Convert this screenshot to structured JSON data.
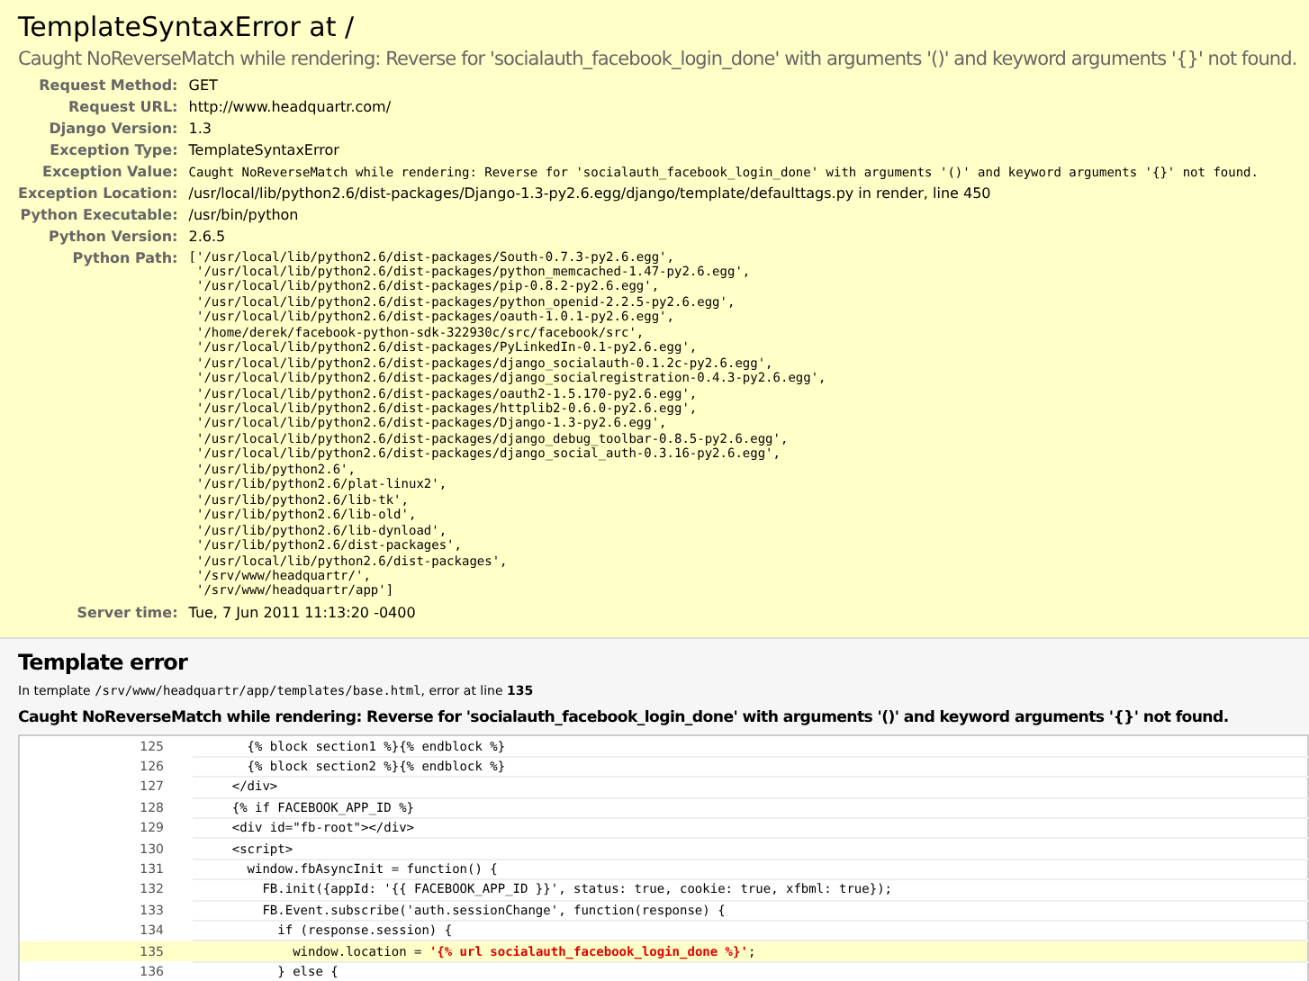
{
  "header": {
    "title": "TemplateSyntaxError at /",
    "message": "Caught NoReverseMatch while rendering: Reverse for 'socialauth_facebook_login_done' with arguments '()' and keyword arguments '{}' not found."
  },
  "meta": [
    {
      "label": "Request Method:",
      "kind": "text",
      "value": "GET"
    },
    {
      "label": "Request URL:",
      "kind": "text",
      "value": "http://www.headquartr.com/"
    },
    {
      "label": "Django Version:",
      "kind": "text",
      "value": "1.3"
    },
    {
      "label": "Exception Type:",
      "kind": "text",
      "value": "TemplateSyntaxError"
    },
    {
      "label": "Exception Value:",
      "kind": "mono",
      "value": "Caught NoReverseMatch while rendering: Reverse for 'socialauth_facebook_login_done' with arguments '()' and keyword arguments '{}' not found."
    },
    {
      "label": "Exception Location:",
      "kind": "text",
      "value": "/usr/local/lib/python2.6/dist-packages/Django-1.3-py2.6.egg/django/template/defaulttags.py in render, line 450"
    },
    {
      "label": "Python Executable:",
      "kind": "text",
      "value": "/usr/bin/python"
    },
    {
      "label": "Python Version:",
      "kind": "text",
      "value": "2.6.5"
    },
    {
      "label": "Python Path:",
      "kind": "lines",
      "lines": [
        "['/usr/local/lib/python2.6/dist-packages/South-0.7.3-py2.6.egg',",
        " '/usr/local/lib/python2.6/dist-packages/python_memcached-1.47-py2.6.egg',",
        " '/usr/local/lib/python2.6/dist-packages/pip-0.8.2-py2.6.egg',",
        " '/usr/local/lib/python2.6/dist-packages/python_openid-2.2.5-py2.6.egg',",
        " '/usr/local/lib/python2.6/dist-packages/oauth-1.0.1-py2.6.egg',",
        " '/home/derek/facebook-python-sdk-322930c/src/facebook/src',",
        " '/usr/local/lib/python2.6/dist-packages/PyLinkedIn-0.1-py2.6.egg',",
        " '/usr/local/lib/python2.6/dist-packages/django_socialauth-0.1.2c-py2.6.egg',",
        " '/usr/local/lib/python2.6/dist-packages/django_socialregistration-0.4.3-py2.6.egg',",
        " '/usr/local/lib/python2.6/dist-packages/oauth2-1.5.170-py2.6.egg',",
        " '/usr/local/lib/python2.6/dist-packages/httplib2-0.6.0-py2.6.egg',",
        " '/usr/local/lib/python2.6/dist-packages/Django-1.3-py2.6.egg',",
        " '/usr/local/lib/python2.6/dist-packages/django_debug_toolbar-0.8.5-py2.6.egg',",
        " '/usr/local/lib/python2.6/dist-packages/django_social_auth-0.3.16-py2.6.egg',",
        " '/usr/lib/python2.6',",
        " '/usr/lib/python2.6/plat-linux2',",
        " '/usr/lib/python2.6/lib-tk',",
        " '/usr/lib/python2.6/lib-old',",
        " '/usr/lib/python2.6/lib-dynload',",
        " '/usr/lib/python2.6/dist-packages',",
        " '/usr/local/lib/python2.6/dist-packages',",
        " '/srv/www/headquartr/',",
        " '/srv/www/headquartr/app']"
      ]
    },
    {
      "label": "Server time:",
      "kind": "text",
      "value": "Tue, 7 Jun 2011 11:13:20 -0400"
    }
  ],
  "template_error": {
    "title": "Template error",
    "prefix": "In template",
    "file": "/srv/www/headquartr/app/templates/base.html",
    "middle": ", error at line",
    "line": "135",
    "message": "Caught NoReverseMatch while rendering: Reverse for 'socialauth_facebook_login_done' with arguments '()' and keyword arguments '{}' not found.",
    "lines": [
      {
        "number": "125",
        "code": "      {% block section1 %}{% endblock %}",
        "highlighted": false
      },
      {
        "number": "126",
        "code": "      {% block section2 %}{% endblock %}",
        "highlighted": false
      },
      {
        "number": "127",
        "code": "    </div>",
        "highlighted": false
      },
      {
        "number": "128",
        "code": "    {% if FACEBOOK_APP_ID %}",
        "highlighted": false
      },
      {
        "number": "129",
        "code": "    <div id=\"fb-root\"></div>",
        "highlighted": false
      },
      {
        "number": "130",
        "code": "    <script>",
        "highlighted": false
      },
      {
        "number": "131",
        "code": "      window.fbAsyncInit = function() {",
        "highlighted": false
      },
      {
        "number": "132",
        "code": "        FB.init({appId: '{{ FACEBOOK_APP_ID }}', status: true, cookie: true, xfbml: true});",
        "highlighted": false
      },
      {
        "number": "133",
        "code": "        FB.Event.subscribe('auth.sessionChange', function(response) {",
        "highlighted": false
      },
      {
        "number": "134",
        "code": "          if (response.session) {",
        "highlighted": false
      },
      {
        "number": "135",
        "code": "            window.location = ",
        "error": "'{% url socialauth_facebook_login_done %}'",
        "after": ";",
        "highlighted": true
      },
      {
        "number": "136",
        "code": "          } else {",
        "highlighted": false
      }
    ]
  }
}
